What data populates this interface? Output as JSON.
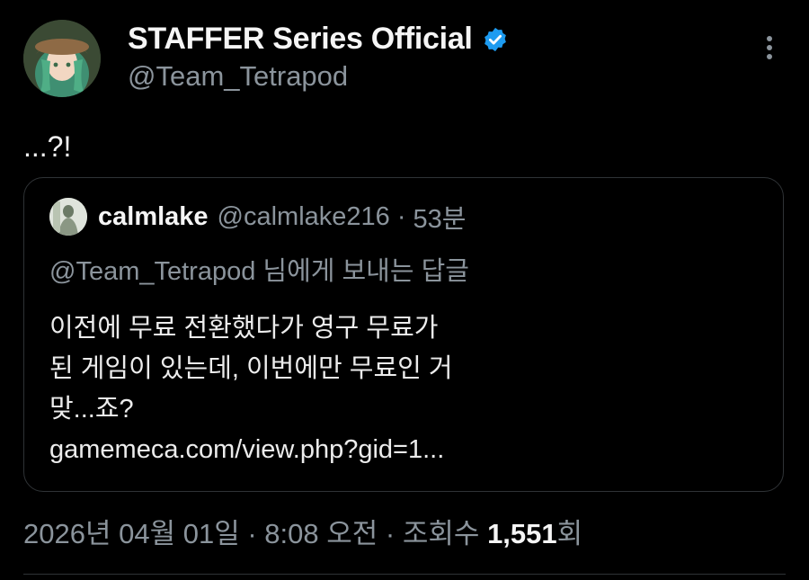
{
  "author": {
    "display_name": "STAFFER Series Official",
    "handle": "@Team_Tetrapod",
    "verified_color": "#1d9bf0"
  },
  "tweet": {
    "text": "...?!"
  },
  "quote": {
    "name": "calmlake",
    "handle": "@calmlake216",
    "separator": "·",
    "time": "53분",
    "reply_to": "@Team_Tetrapod 님에게 보내는 답글",
    "lines": [
      "이전에 무료 전환했다가 영구 무료가",
      "된 게임이 있는데, 이번에만 무료인 거",
      "맞...죠?",
      "gamemeca.com/view.php?gid=1..."
    ]
  },
  "footer": {
    "date": "2026년 04월 01일",
    "time": "8:08 오전",
    "views_label": "조회수",
    "views_count": "1,551",
    "views_suffix": "회",
    "separator": "·"
  },
  "icons": {
    "more": "more-vertical-icon",
    "verified": "verified-badge-icon"
  }
}
